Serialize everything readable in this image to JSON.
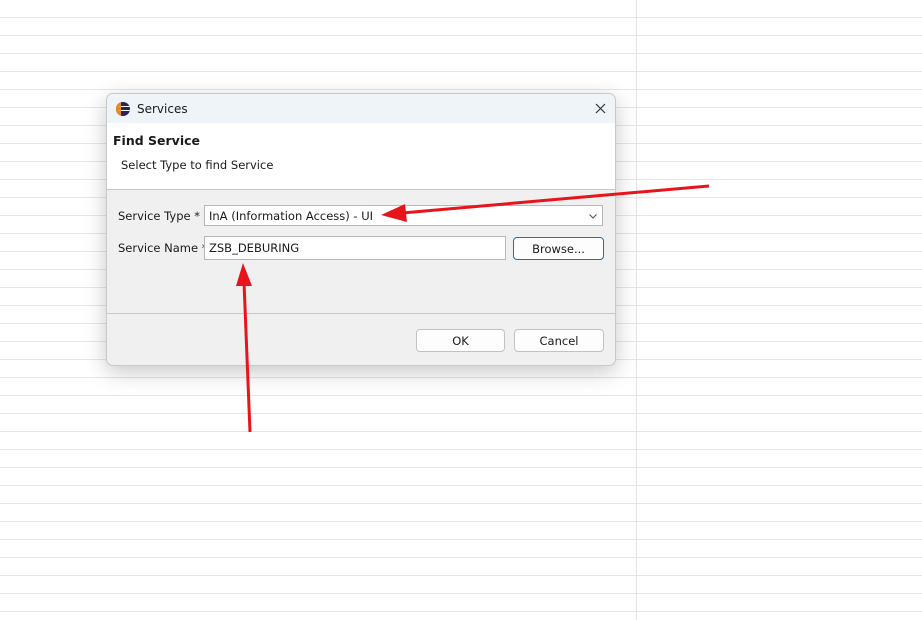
{
  "window": {
    "title": "Services",
    "app_icon": "eclipse-icon",
    "close_icon": "close-icon"
  },
  "header": {
    "title": "Find Service",
    "subtitle": "Select Type to find Service"
  },
  "form": {
    "service_type_label": "Service Type *",
    "service_type_value": "InA (Information Access) - UI",
    "service_name_label": "Service Name *",
    "service_name_value": "ZSB_DEBURING",
    "browse_label": "Browse..."
  },
  "buttons": {
    "ok_label": "OK",
    "cancel_label": "Cancel"
  },
  "colors": {
    "annotation_arrow": "#e8141b",
    "dialog_background": "#f0f0f0",
    "title_bar": "#eff4f9",
    "focus_border": "#2b6cb0"
  }
}
